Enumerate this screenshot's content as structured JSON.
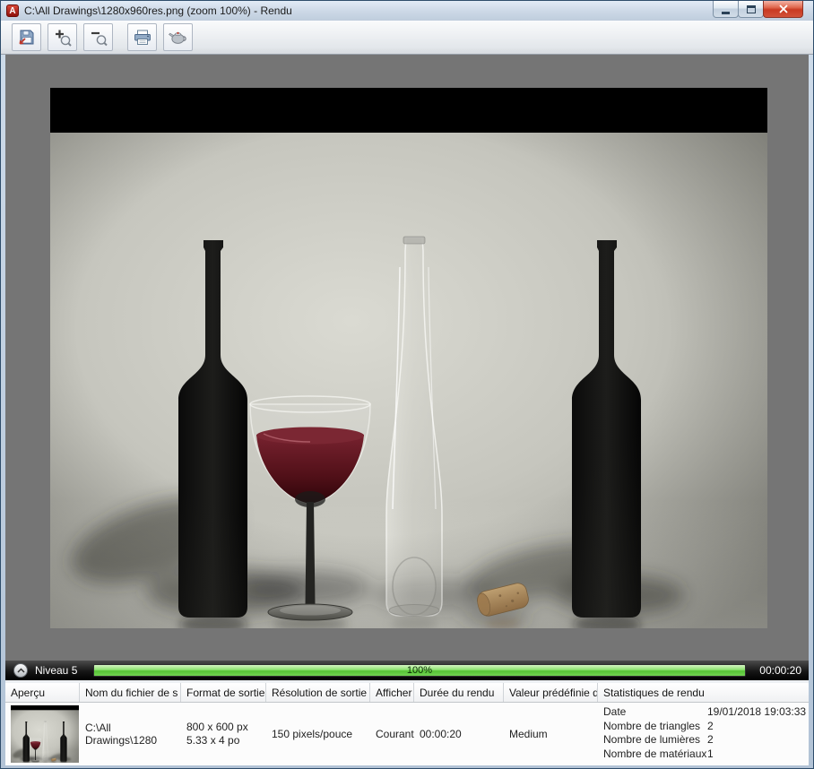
{
  "window": {
    "title": "C:\\All Drawings\\1280x960res.png (zoom 100%) - Rendu",
    "app_badge": "A"
  },
  "toolbar": {
    "buttons": [
      {
        "icon": "save-icon"
      },
      {
        "icon": "zoom-in-icon"
      },
      {
        "icon": "zoom-out-icon"
      },
      {
        "icon": "print-icon"
      },
      {
        "icon": "teapot-icon"
      }
    ]
  },
  "progress": {
    "level": "Niveau 5",
    "percent": "100%",
    "elapsed": "00:00:20",
    "bar_color": "#55c434"
  },
  "table": {
    "headers": [
      "Aperçu",
      "Nom du fichier de s",
      "Format de sortie",
      "Résolution de sortie",
      "Afficher",
      "Durée du rendu",
      "Valeur prédéfinie d",
      "Statistiques de rendu"
    ],
    "row": {
      "file_name": "C:\\All Drawings\\1280",
      "format_line1": "800 x 600 px",
      "format_line2": "5.33 x 4 po",
      "resolution": "150 pixels/pouce",
      "display": "Courant",
      "duration": "00:00:20",
      "preset": "Medium",
      "stats": [
        {
          "label": "Date",
          "value": "19/01/2018 19:03:33"
        },
        {
          "label": "Nombre de triangles",
          "value": "2"
        },
        {
          "label": "Nombre de lumières",
          "value": "2"
        },
        {
          "label": "Nombre de matériaux",
          "value": "1"
        }
      ]
    }
  },
  "colors": {
    "wine_red": "#511018",
    "progress_green": "#55c434",
    "close_button_red": "#c93a22",
    "viewport_gray": "#757575"
  }
}
